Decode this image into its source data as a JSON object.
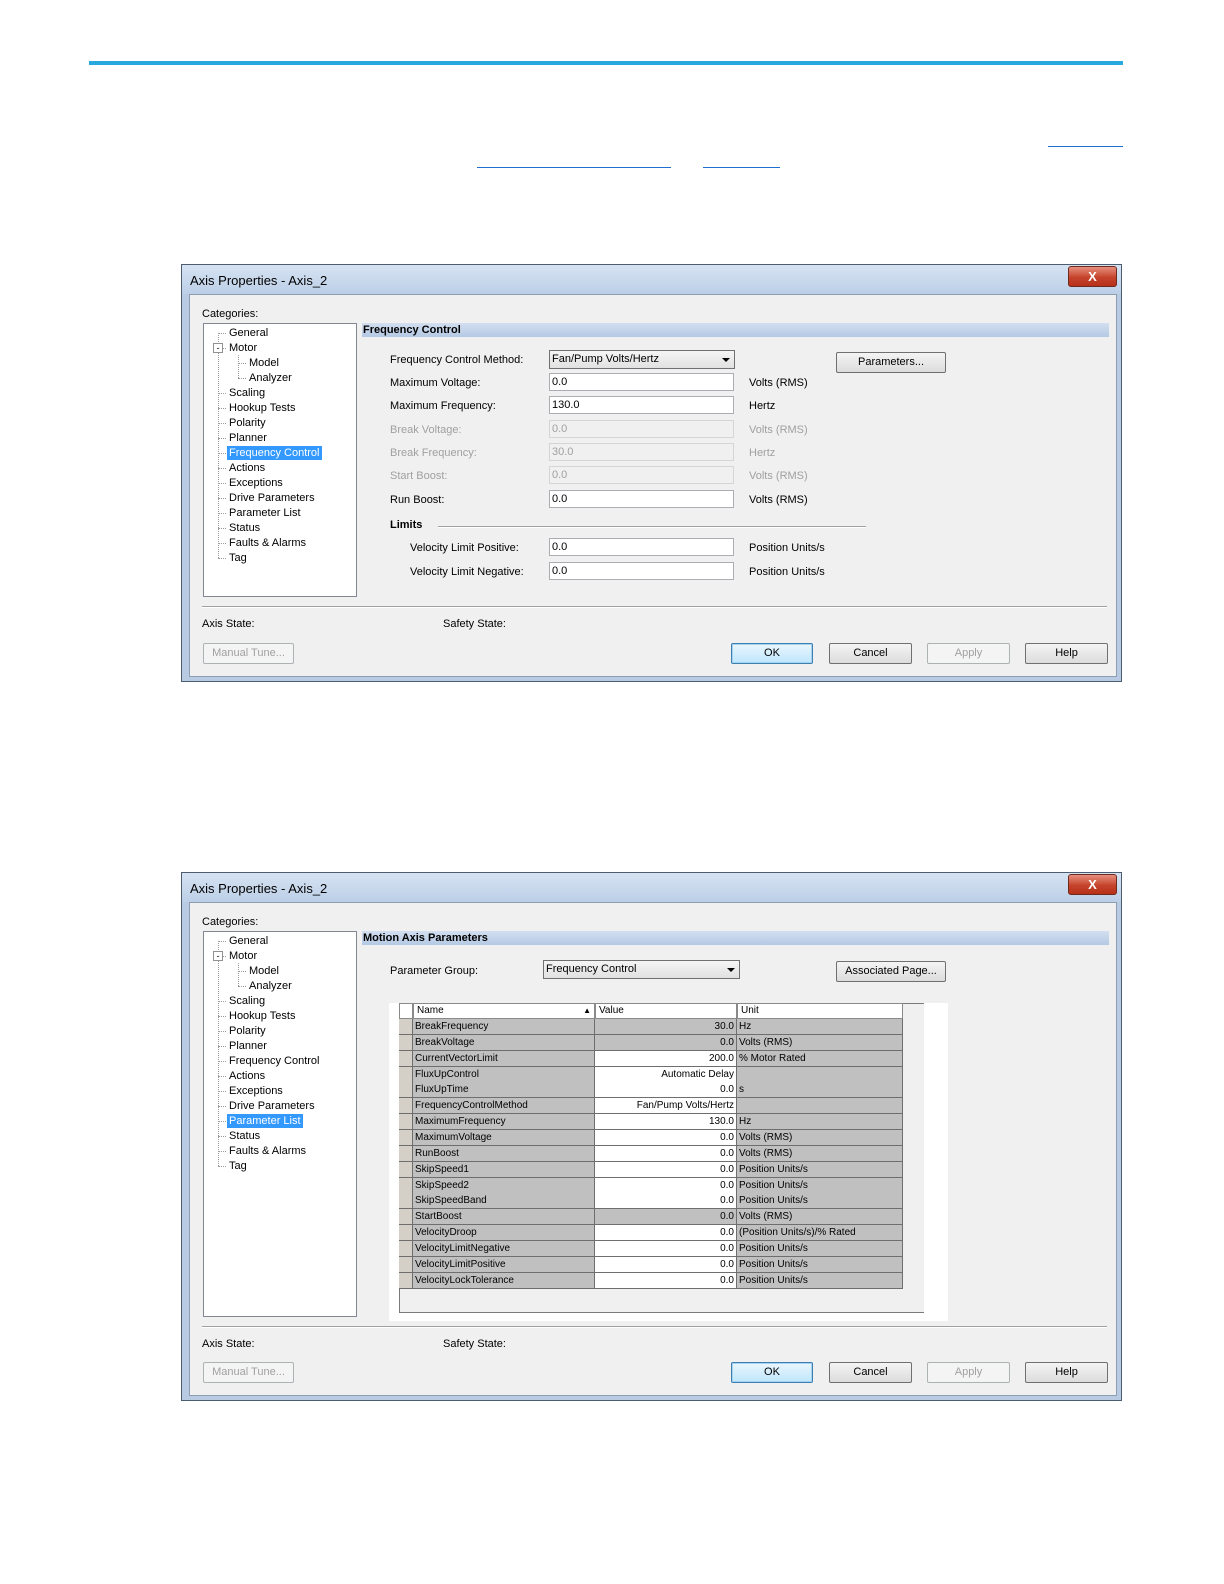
{
  "dialog1": {
    "title": "Axis Properties - Axis_2",
    "close": "X",
    "categories_label": "Categories:",
    "tree": [
      {
        "label": "General",
        "level": 1
      },
      {
        "label": "Motor",
        "level": 1,
        "expander": "-"
      },
      {
        "label": "Model",
        "level": 2
      },
      {
        "label": "Analyzer",
        "level": 2
      },
      {
        "label": "Scaling",
        "level": 1
      },
      {
        "label": "Hookup Tests",
        "level": 1
      },
      {
        "label": "Polarity",
        "level": 1
      },
      {
        "label": "Planner",
        "level": 1
      },
      {
        "label": "Frequency Control",
        "level": 1,
        "selected": true
      },
      {
        "label": "Actions",
        "level": 1
      },
      {
        "label": "Exceptions",
        "level": 1
      },
      {
        "label": "Drive Parameters",
        "level": 1
      },
      {
        "label": "Parameter List",
        "level": 1
      },
      {
        "label": "Status",
        "level": 1
      },
      {
        "label": "Faults & Alarms",
        "level": 1
      },
      {
        "label": "Tag",
        "level": 1
      }
    ],
    "section_title": "Frequency Control",
    "method_label": "Frequency Control Method:",
    "method_value": "Fan/Pump Volts/Hertz",
    "parameters_button": "Parameters...",
    "fields": [
      {
        "label": "Maximum Voltage:",
        "value": "0.0",
        "unit": "Volts (RMS)",
        "enabled": true
      },
      {
        "label": "Maximum Frequency:",
        "value": "130.0",
        "unit": "Hertz",
        "enabled": true
      },
      {
        "label": "Break Voltage:",
        "value": "0.0",
        "unit": "Volts (RMS)",
        "enabled": false
      },
      {
        "label": "Break Frequency:",
        "value": "30.0",
        "unit": "Hertz",
        "enabled": false
      },
      {
        "label": "Start Boost:",
        "value": "0.0",
        "unit": "Volts (RMS)",
        "enabled": false
      },
      {
        "label": "Run Boost:",
        "value": "0.0",
        "unit": "Volts (RMS)",
        "enabled": true
      }
    ],
    "limits_label": "Limits",
    "limits": [
      {
        "label": "Velocity Limit Positive:",
        "value": "0.0",
        "unit": "Position Units/s"
      },
      {
        "label": "Velocity Limit Negative:",
        "value": "0.0",
        "unit": "Position Units/s"
      }
    ],
    "axis_state_label": "Axis State:",
    "safety_state_label": "Safety State:",
    "manual_tune": "Manual Tune...",
    "ok": "OK",
    "cancel": "Cancel",
    "apply": "Apply",
    "help": "Help"
  },
  "dialog2": {
    "title": "Axis Properties - Axis_2",
    "close": "X",
    "categories_label": "Categories:",
    "tree": [
      {
        "label": "General",
        "level": 1
      },
      {
        "label": "Motor",
        "level": 1,
        "expander": "-"
      },
      {
        "label": "Model",
        "level": 2
      },
      {
        "label": "Analyzer",
        "level": 2
      },
      {
        "label": "Scaling",
        "level": 1
      },
      {
        "label": "Hookup Tests",
        "level": 1
      },
      {
        "label": "Polarity",
        "level": 1
      },
      {
        "label": "Planner",
        "level": 1
      },
      {
        "label": "Frequency Control",
        "level": 1
      },
      {
        "label": "Actions",
        "level": 1
      },
      {
        "label": "Exceptions",
        "level": 1
      },
      {
        "label": "Drive Parameters",
        "level": 1
      },
      {
        "label": "Parameter List",
        "level": 1,
        "selected": true
      },
      {
        "label": "Status",
        "level": 1
      },
      {
        "label": "Faults & Alarms",
        "level": 1
      },
      {
        "label": "Tag",
        "level": 1
      }
    ],
    "section_title": "Motion Axis Parameters",
    "group_label": "Parameter Group:",
    "group_value": "Frequency Control",
    "associated_page": "Associated Page...",
    "columns": [
      "Name",
      "Value",
      "Unit"
    ],
    "sort_indicator": "▲",
    "rows": [
      {
        "name": "BreakFrequency",
        "value": "30.0",
        "unit": "Hz",
        "editable": false
      },
      {
        "name": "BreakVoltage",
        "value": "0.0",
        "unit": "Volts (RMS)",
        "editable": false
      },
      {
        "name": "CurrentVectorLimit",
        "value": "200.0",
        "unit": "% Motor Rated",
        "editable": true
      },
      {
        "name": "FluxUpControl",
        "value": "Automatic Delay",
        "unit": "",
        "editable": true
      },
      {
        "name": "FluxUpTime",
        "value": "0.0",
        "unit": "s",
        "editable": true
      },
      {
        "name": "FrequencyControlMethod",
        "value": "Fan/Pump Volts/Hertz",
        "unit": "",
        "editable": true
      },
      {
        "name": "MaximumFrequency",
        "value": "130.0",
        "unit": "Hz",
        "editable": true
      },
      {
        "name": "MaximumVoltage",
        "value": "0.0",
        "unit": "Volts (RMS)",
        "editable": true
      },
      {
        "name": "RunBoost",
        "value": "0.0",
        "unit": "Volts (RMS)",
        "editable": true
      },
      {
        "name": "SkipSpeed1",
        "value": "0.0",
        "unit": "Position Units/s",
        "editable": true
      },
      {
        "name": "SkipSpeed2",
        "value": "0.0",
        "unit": "Position Units/s",
        "editable": true
      },
      {
        "name": "SkipSpeedBand",
        "value": "0.0",
        "unit": "Position Units/s",
        "editable": true
      },
      {
        "name": "StartBoost",
        "value": "0.0",
        "unit": "Volts (RMS)",
        "editable": false
      },
      {
        "name": "VelocityDroop",
        "value": "0.0",
        "unit": "(Position Units/s)/% Rated",
        "editable": true
      },
      {
        "name": "VelocityLimitNegative",
        "value": "0.0",
        "unit": "Position Units/s",
        "editable": true
      },
      {
        "name": "VelocityLimitPositive",
        "value": "0.0",
        "unit": "Position Units/s",
        "editable": true
      },
      {
        "name": "VelocityLockTolerance",
        "value": "0.0",
        "unit": "Position Units/s",
        "editable": true
      }
    ],
    "axis_state_label": "Axis State:",
    "safety_state_label": "Safety State:",
    "manual_tune": "Manual Tune...",
    "ok": "OK",
    "cancel": "Cancel",
    "apply": "Apply",
    "help": "Help"
  }
}
